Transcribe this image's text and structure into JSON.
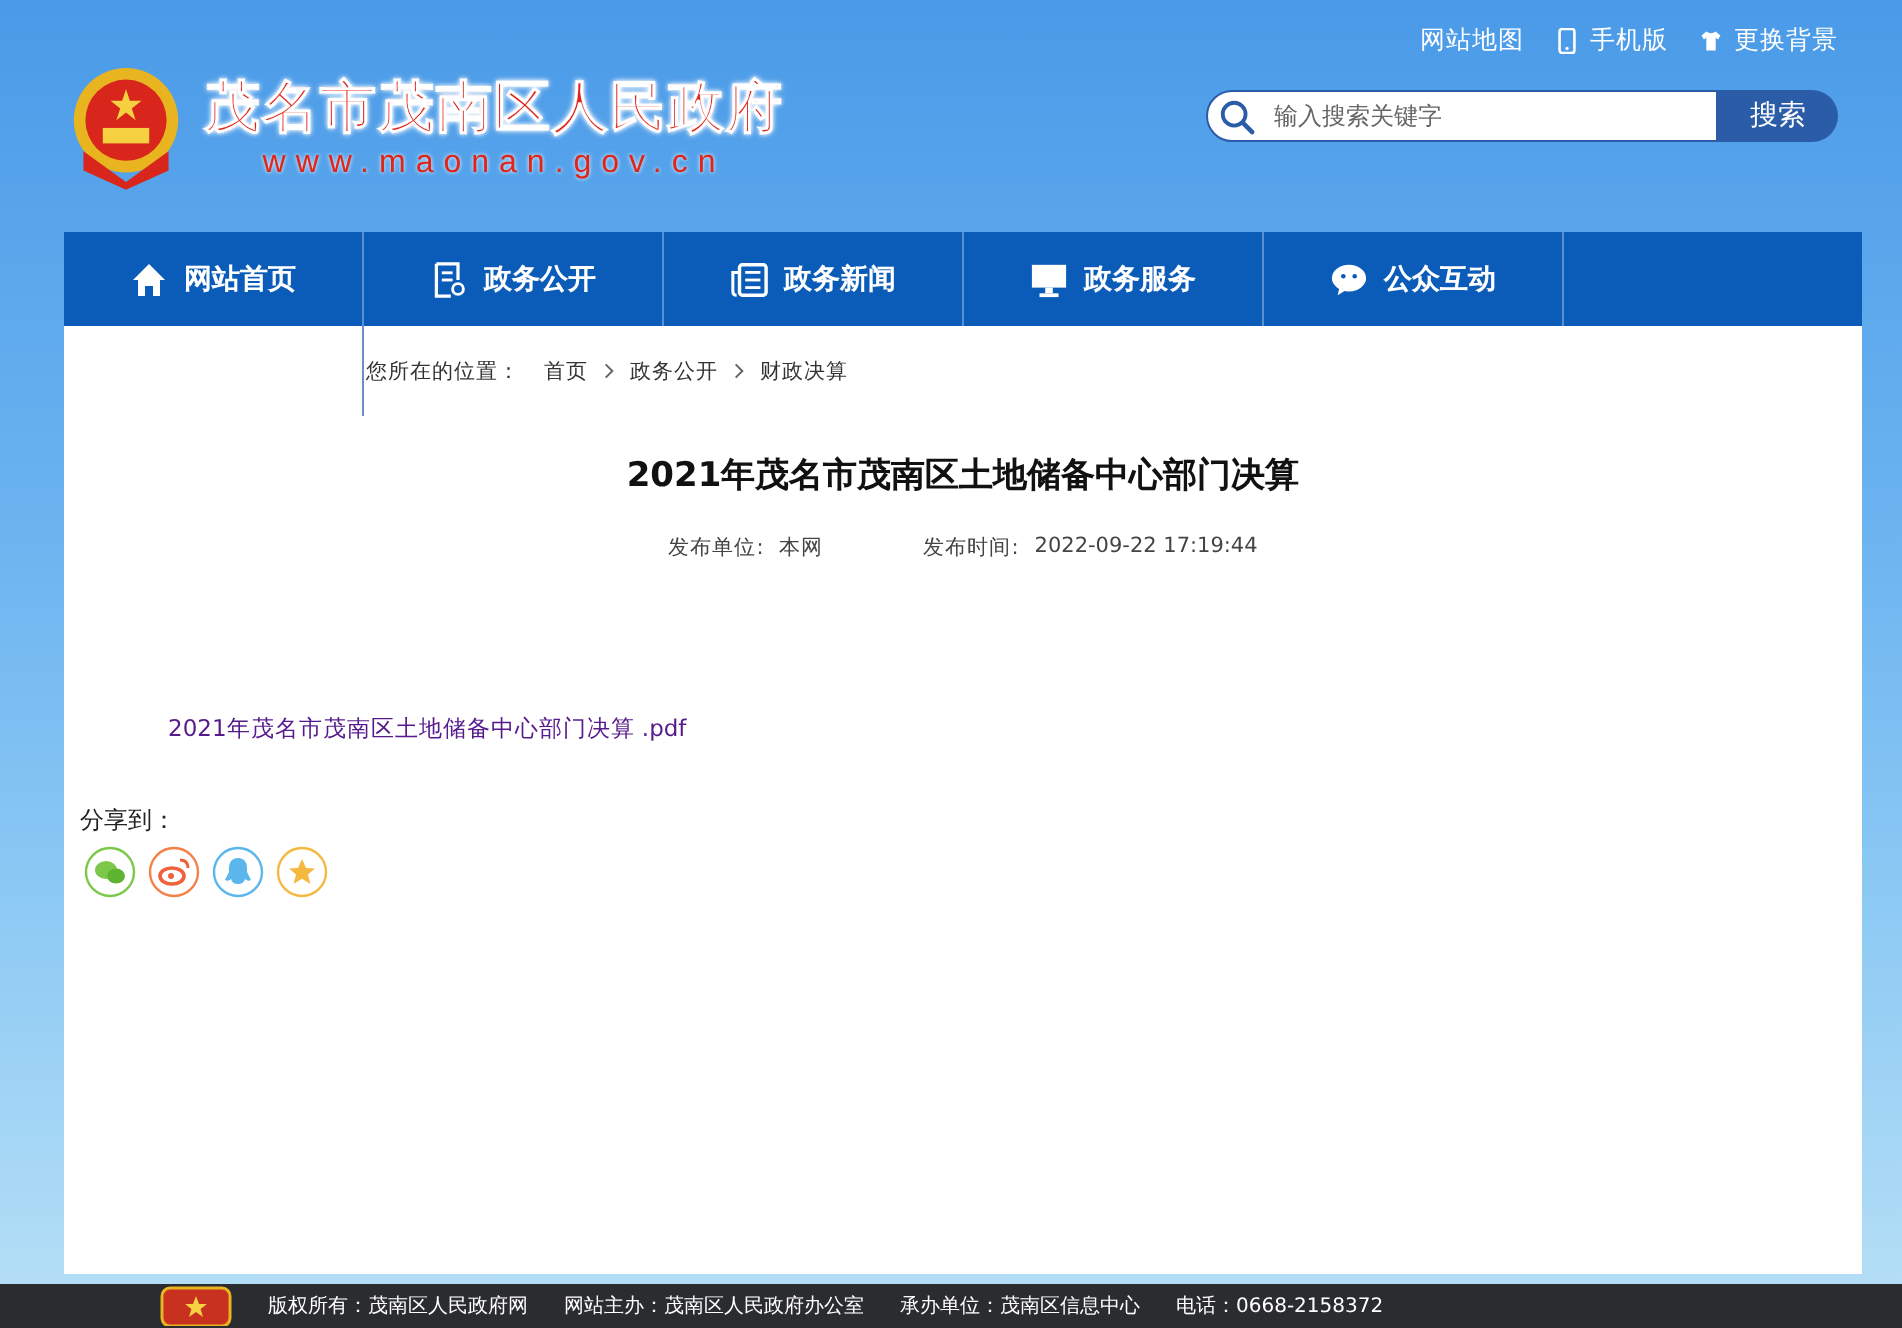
{
  "header": {
    "site_title": "茂名市茂南区人民政府",
    "domain": "www.maonan.gov.cn",
    "top_links": [
      {
        "label": "网站地图"
      },
      {
        "label": "手机版"
      },
      {
        "label": "更换背景"
      }
    ],
    "search": {
      "placeholder": "输入搜索关键字",
      "button": "搜索"
    }
  },
  "nav": {
    "items": [
      {
        "label": "网站首页"
      },
      {
        "label": "政务公开"
      },
      {
        "label": "政务新闻"
      },
      {
        "label": "政务服务"
      },
      {
        "label": "公众互动"
      }
    ]
  },
  "breadcrumb": {
    "label": "您所在的位置：",
    "items": [
      "首页",
      "政务公开",
      "财政决算"
    ]
  },
  "article": {
    "title": "2021年茂名市茂南区土地储备中心部门决算",
    "meta": [
      {
        "label": "发布单位:",
        "value": "本网"
      },
      {
        "label": "发布时间:",
        "value": "2022-09-22 17:19:44"
      }
    ],
    "attachment": "2021年茂名市茂南区土地储备中心部门决算 .pdf",
    "share_label": "分享到："
  },
  "footer": {
    "items": [
      "版权所有：茂南区人民政府网",
      "网站主办：茂南区人民政府办公室",
      "承办单位：茂南区信息中心",
      "电话：0668-2158372"
    ]
  }
}
